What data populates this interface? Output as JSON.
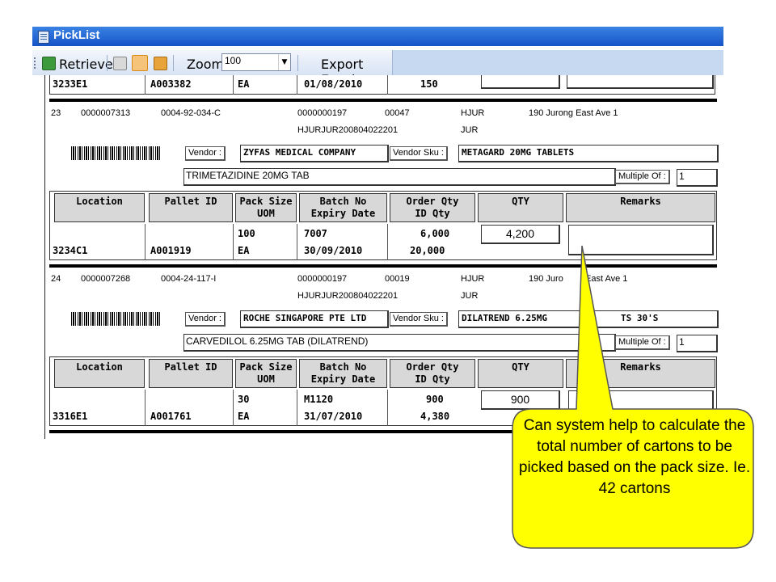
{
  "window": {
    "title": "PickList"
  },
  "toolbar": {
    "retrieve_label": "Retrieve",
    "zoom_label": "Zoom",
    "zoom_value": "100",
    "export_label": "Export Excel"
  },
  "top_row": {
    "location": "3233E1",
    "pallet": "A003382",
    "uom": "EA",
    "expiry": "01/08/2010",
    "id_qty": "150"
  },
  "headers": {
    "location": "Location",
    "pallet": "Pallet ID",
    "pack1": "Pack Size",
    "pack2": "UOM",
    "batch1": "Batch No",
    "batch2": "Expiry Date",
    "order1": "Order Qty",
    "order2": "ID Qty",
    "qty": "QTY",
    "remarks": "Remarks"
  },
  "labels": {
    "vendor": "Vendor :",
    "vendor_sku": "Vendor Sku :",
    "multiple_of": "Multiple Of :"
  },
  "items": [
    {
      "seq": "23",
      "code1": "0000007313",
      "code2": "0004-92-034-C",
      "code3": "0000000197",
      "code4": "00047",
      "code5": "HJUR",
      "address": "190 Jurong East Ave 1",
      "ref": "HJURJUR200804022201",
      "ref2": "JUR",
      "vendor": "ZYFAS MEDICAL COMPANY",
      "vendor_sku": "METAGARD 20MG TABLETS",
      "description": "TRIMETAZIDINE 20MG TAB",
      "multiple": "1",
      "location": "3234C1",
      "pallet": "A001919",
      "pack_size": "100",
      "uom": "EA",
      "batch": "7007",
      "expiry": "30/09/2010",
      "order_qty": "6,000",
      "id_qty": "20,000",
      "qty": "4,200",
      "remarks": ""
    },
    {
      "seq": "24",
      "code1": "0000007268",
      "code2": "0004-24-117-I",
      "code3": "0000000197",
      "code4": "00019",
      "code5": "HJUR",
      "address": "190 Juro",
      "address_tail": "East Ave 1",
      "ref": "HJURJUR200804022201",
      "ref2": "JUR",
      "vendor": "ROCHE SINGAPORE PTE LTD",
      "vendor_sku": "DILATREND 6.25MG",
      "vendor_sku_tail": "TS 30'S",
      "description": "CARVEDILOL 6.25MG TAB (DILATREND)",
      "multiple": "1",
      "location": "3316E1",
      "pallet": "A001761",
      "pack_size": "30",
      "uom": "EA",
      "batch": "M1120",
      "expiry": "31/07/2010",
      "order_qty": "900",
      "id_qty": "4,380",
      "qty": "900",
      "remarks": ""
    }
  ],
  "callout": {
    "text": "Can system help to calculate the total number of cartons to be picked based on the pack size. Ie. 42 cartons",
    "fill": "#ffff00"
  }
}
